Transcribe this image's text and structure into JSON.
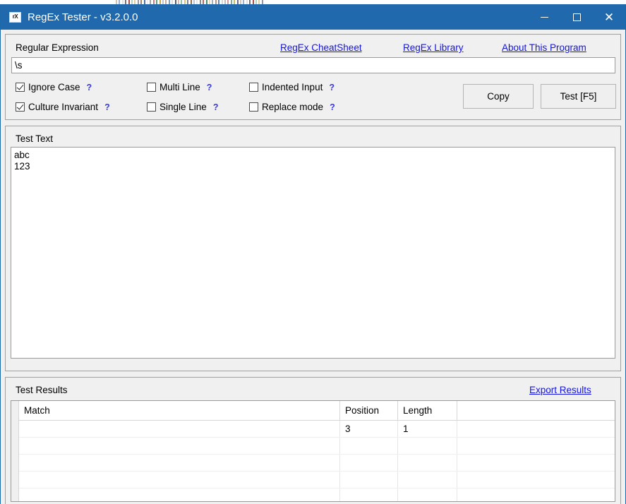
{
  "window": {
    "title": "RegEx Tester - v3.2.0.0",
    "icon_label": "rX",
    "icon_name": "regex-tester-app-icon",
    "titlebar_color": "#1f69ac",
    "controls": {
      "minimize": "—",
      "maximize": "□",
      "close": "✕"
    }
  },
  "regex_panel": {
    "label": "Regular Expression",
    "links": [
      {
        "label": "RegEx CheatSheet",
        "name": "regex-cheatsheet-link"
      },
      {
        "label": "RegEx Library",
        "name": "regex-library-link"
      },
      {
        "label": "About This Program",
        "name": "about-this-program-link"
      }
    ],
    "input": {
      "value": "\\s",
      "placeholder": ""
    },
    "options": [
      {
        "label": "Ignore Case",
        "checked": true,
        "help": "?"
      },
      {
        "label": "Multi Line",
        "checked": false,
        "help": "?"
      },
      {
        "label": "Indented Input",
        "checked": false,
        "help": "?"
      },
      {
        "label": "Culture Invariant",
        "checked": true,
        "help": "?"
      },
      {
        "label": "Single Line",
        "checked": false,
        "help": "?"
      },
      {
        "label": "Replace mode",
        "checked": false,
        "help": "?"
      }
    ],
    "buttons": {
      "copy": "Copy",
      "test": "Test [F5]"
    }
  },
  "test_text_panel": {
    "label": "Test Text",
    "value": "abc\n123"
  },
  "results_panel": {
    "label": "Test Results",
    "export_link": "Export Results",
    "columns": [
      "Match",
      "Position",
      "Length",
      ""
    ],
    "rows": [
      {
        "match": " ",
        "position": "3",
        "length": "1",
        "extra": ""
      },
      {
        "match": "",
        "position": "",
        "length": "",
        "extra": ""
      },
      {
        "match": "",
        "position": "",
        "length": "",
        "extra": ""
      },
      {
        "match": "",
        "position": "",
        "length": "",
        "extra": ""
      },
      {
        "match": "",
        "position": "",
        "length": "",
        "extra": ""
      }
    ]
  },
  "colors": {
    "link": "#1414e0",
    "titlebar": "#1f69ac",
    "panel": "#f0f0f0"
  }
}
